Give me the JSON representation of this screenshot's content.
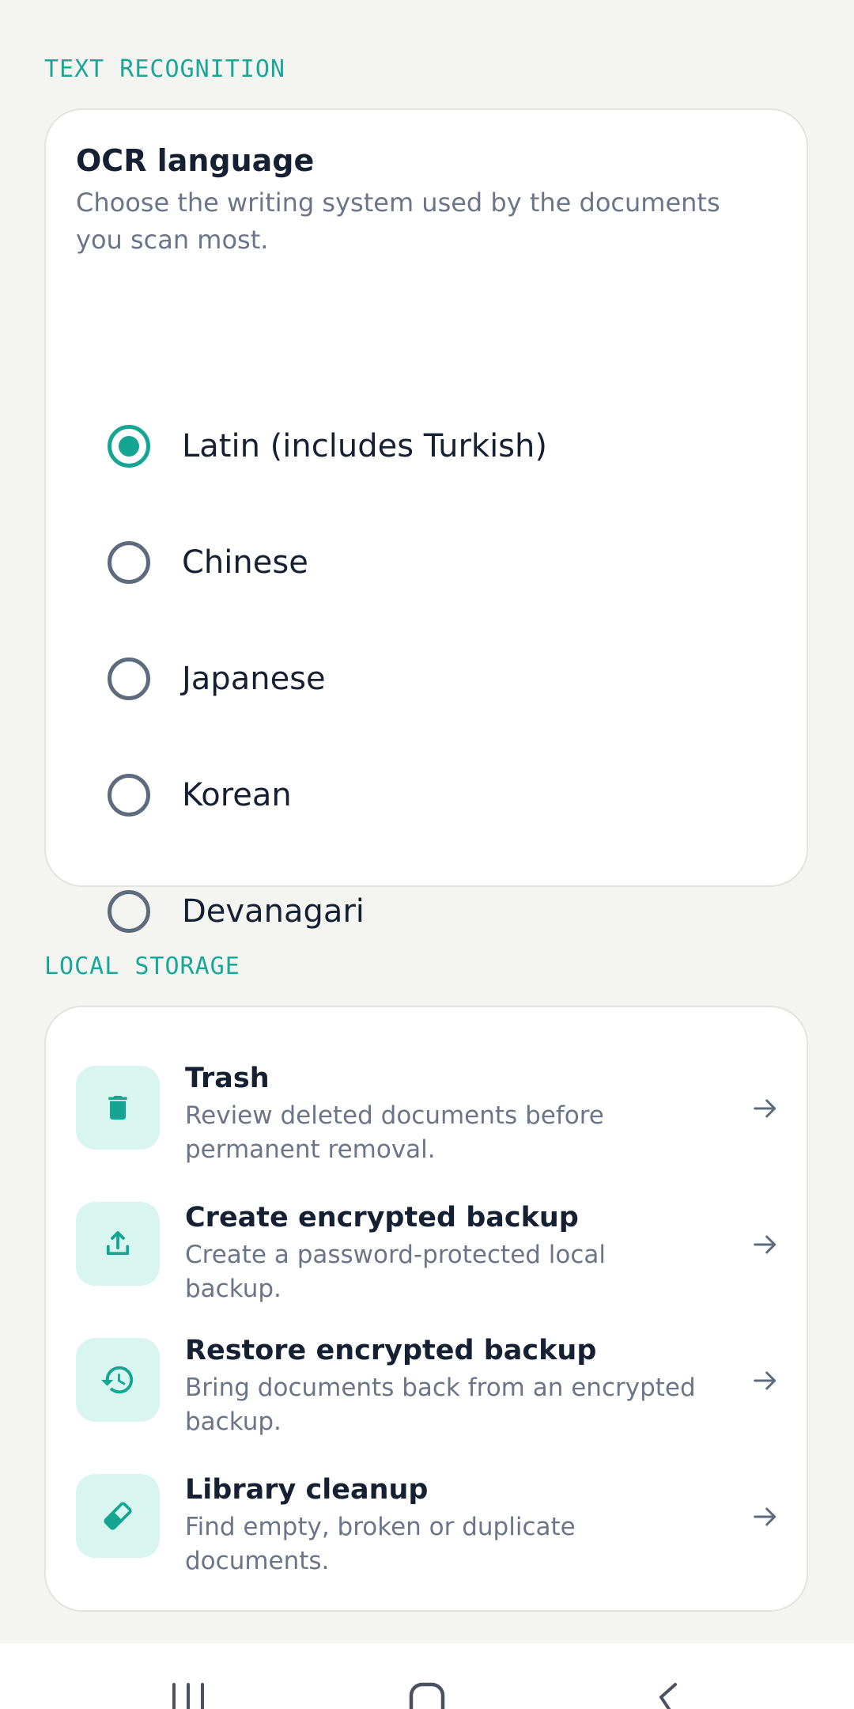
{
  "text_recognition": {
    "section_label": "TEXT RECOGNITION",
    "title": "OCR language",
    "description": "Choose the writing system used by the documents you scan most.",
    "options": [
      {
        "label": "Latin (includes Turkish)",
        "selected": true
      },
      {
        "label": "Chinese",
        "selected": false
      },
      {
        "label": "Japanese",
        "selected": false
      },
      {
        "label": "Korean",
        "selected": false
      },
      {
        "label": "Devanagari",
        "selected": false
      }
    ]
  },
  "local_storage": {
    "section_label": "LOCAL STORAGE",
    "items": [
      {
        "title": "Trash",
        "description": "Review deleted documents before permanent removal.",
        "icon": "trash-icon"
      },
      {
        "title": "Create encrypted backup",
        "description": "Create a password-protected local backup.",
        "icon": "upload-icon"
      },
      {
        "title": "Restore encrypted backup",
        "description": "Bring documents back from an encrypted backup.",
        "icon": "restore-history-icon"
      },
      {
        "title": "Library cleanup",
        "description": "Find empty, broken or duplicate documents.",
        "icon": "eraser-icon"
      }
    ]
  },
  "colors": {
    "accent": "#14a693",
    "icon_tile_bg": "#d9f5ef",
    "background": "#f4f4f1"
  },
  "nav": {
    "buttons": [
      "recent-apps-icon",
      "home-icon",
      "back-icon"
    ]
  }
}
